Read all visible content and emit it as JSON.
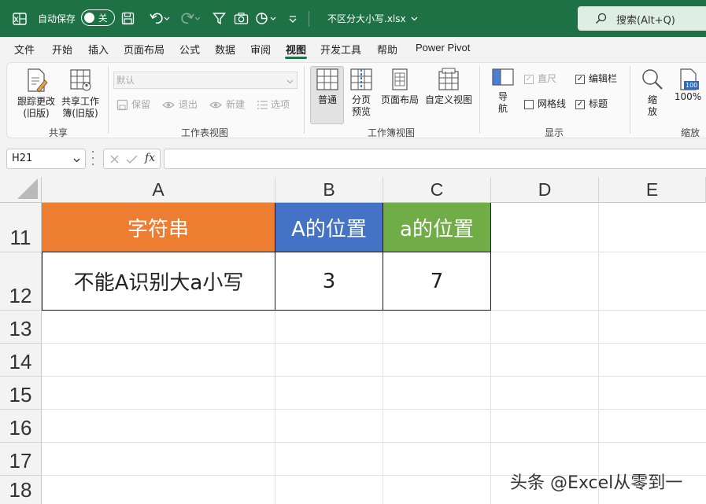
{
  "titlebar": {
    "autosave_label": "自动保存",
    "autosave_state": "关",
    "filename": "不区分大小写.xlsx",
    "search_placeholder": "搜索(Alt+Q)",
    "colors": {
      "background": "#1e7145"
    }
  },
  "menu": {
    "tabs": [
      "文件",
      "开始",
      "插入",
      "页面布局",
      "公式",
      "数据",
      "审阅",
      "视图",
      "开发工具",
      "帮助",
      "Power Pivot"
    ],
    "active_tab": "视图"
  },
  "ribbon": {
    "share_group": {
      "track_changes_label_1": "跟踪更改",
      "track_changes_label_2": "(旧版)",
      "share_workbook_label_1": "共享工作",
      "share_workbook_label_2": "簿(旧版)",
      "group_label": "共享"
    },
    "sheet_view_group": {
      "combo_value": "默认",
      "keep_label": "保留",
      "exit_label": "退出",
      "new_label": "新建",
      "options_label": "选项",
      "group_label": "工作表视图"
    },
    "workbook_view_group": {
      "normal_label": "普通",
      "page_break_label_1": "分页",
      "page_break_label_2": "预览",
      "page_layout_label": "页面布局",
      "custom_view_label": "自定义视图",
      "group_label": "工作簿视图"
    },
    "show_group": {
      "navigation_label_1": "导",
      "navigation_label_2": "航",
      "ruler_label": "直尺",
      "formula_bar_label": "编辑栏",
      "gridlines_label": "网格线",
      "headings_label": "标题",
      "group_label": "显示"
    },
    "zoom_group": {
      "zoom_label_1": "缩",
      "zoom_label_2": "放",
      "zoom_100_label": "100%",
      "zoom_100_icon_text": "100",
      "group_label": "缩放"
    }
  },
  "formula_bar": {
    "name_box": "H21",
    "fx_label": "fx",
    "formula": ""
  },
  "sheet": {
    "columns": [
      "A",
      "B",
      "C",
      "D",
      "E"
    ],
    "rows": [
      "11",
      "12",
      "13",
      "14",
      "15",
      "16",
      "17",
      "18"
    ],
    "header_row": {
      "a": "字符串",
      "b": "A的位置",
      "c": "a的位置",
      "colors": {
        "a": "#ed7d31",
        "b": "#4472c4",
        "c": "#70ad47"
      }
    },
    "data_row": {
      "a": "不能A识别大a小写",
      "b": "3",
      "c": "7"
    }
  },
  "watermark": "头条 @Excel从零到一"
}
